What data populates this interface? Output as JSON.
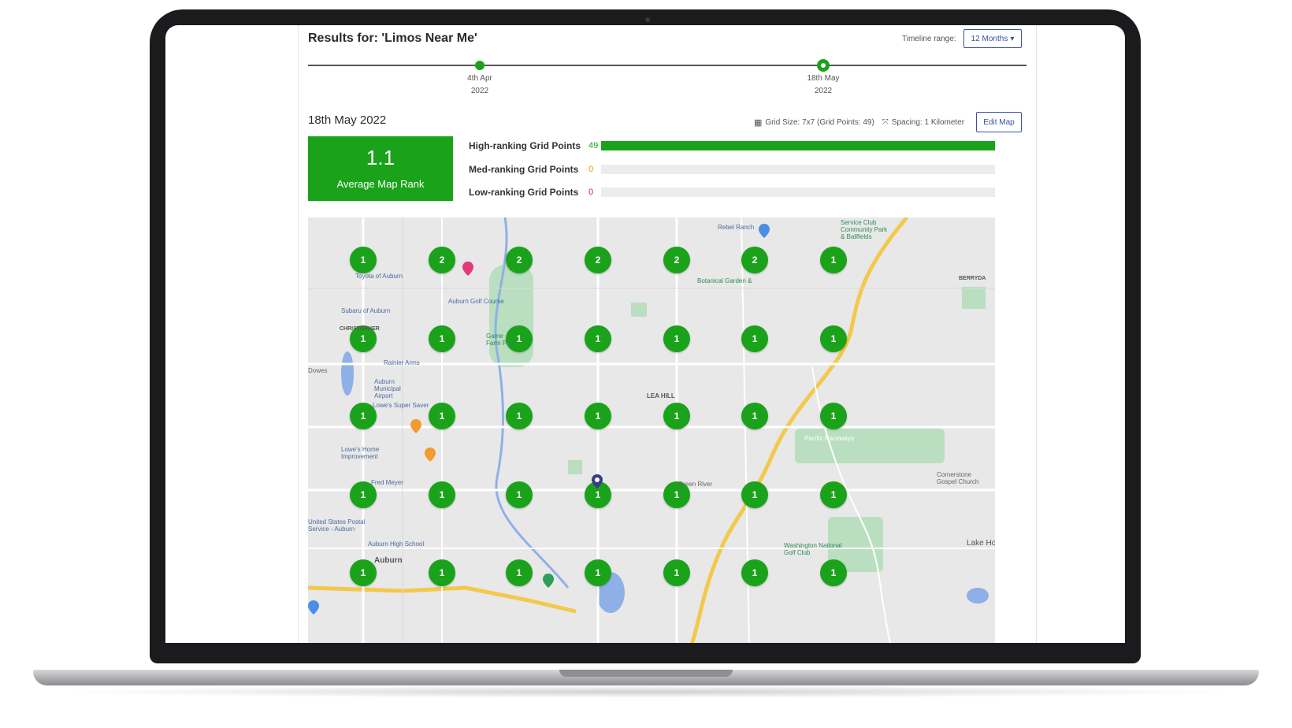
{
  "report": {
    "title": "Results for: 'Limos Near Me'",
    "timeline_label": "Timeline range:",
    "timeline_value": "12 Months",
    "timeline_points": [
      {
        "line1": "4th Apr",
        "line2": "2022",
        "selected": false
      },
      {
        "line1": "18th May",
        "line2": "2022",
        "selected": true
      }
    ],
    "selected_date": "18th May 2022",
    "grid_size_text": "Grid Size: 7x7 (Grid Points: 49)",
    "spacing_text": "Spacing: 1 Kilometer",
    "edit_map_label": "Edit Map"
  },
  "summary": {
    "average_rank": "1.1",
    "average_rank_label": "Average Map Rank",
    "bars": [
      {
        "label": "High-ranking Grid Points",
        "count": "49",
        "fraction": 1.0,
        "color": "#1aa31a"
      },
      {
        "label": "Med-ranking Grid Points",
        "count": "0",
        "fraction": 0.0,
        "color": "#e0a000"
      },
      {
        "label": "Low-ranking Grid Points",
        "count": "0",
        "fraction": 0.0,
        "color": "#d22"
      }
    ]
  },
  "grid_ranks": [
    [
      "1",
      "2",
      "2",
      "2",
      "2",
      "2",
      "1"
    ],
    [
      "1",
      "1",
      "1",
      "1",
      "1",
      "1",
      "1"
    ],
    [
      "1",
      "1",
      "1",
      "1",
      "1",
      "1",
      "1"
    ],
    [
      "1",
      "1",
      "1",
      "1",
      "1",
      "1",
      "1"
    ],
    [
      "1",
      "1",
      "1",
      "1",
      "1",
      "1",
      "1"
    ]
  ],
  "map_labels": [
    "Rebel Ranch",
    "Service Club Community Park & Ballfields",
    "Auburn Golf Course",
    "Game Farm Park",
    "Rainier Arms",
    "Auburn Municipal Airport",
    "Lowe's Super Saver",
    "Lowe's Home Improvement",
    "Fred Meyer",
    "United States Postal Service - Auburn",
    "Auburn High School",
    "Auburn",
    "LEA HILL",
    "Pacific Raceways",
    "Cornerstone Gospel Church",
    "Washington National Golf Club",
    "Lake Hol",
    "BERRYDA",
    "Botanical Garden &",
    "Subaru of Auburn",
    "Toyota of Auburn",
    "Green River",
    "CHRISTOPHER",
    "Dowes",
    "Game Farm"
  ],
  "colors": {
    "accent": "#1aa31a",
    "link": "#3b4fa8"
  }
}
